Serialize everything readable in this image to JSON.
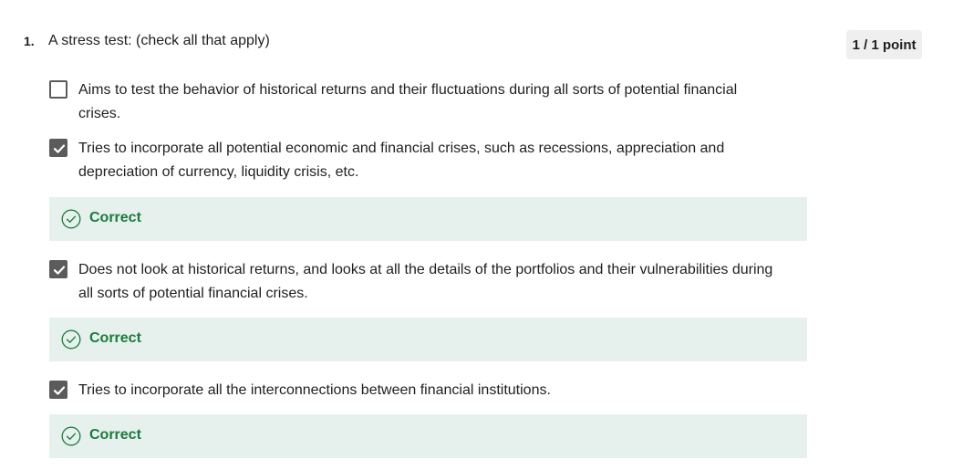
{
  "question": {
    "number": "1.",
    "text": "A stress test: (check all that apply)",
    "points": "1 / 1 point"
  },
  "options": [
    {
      "label": "Aims to test the behavior of historical returns and their fluctuations during all sorts of potential financial crises.",
      "checked": false
    },
    {
      "label": "Tries to incorporate all potential economic and financial crises, such as recessions, appreciation and depreciation of currency, liquidity crisis, etc.",
      "checked": true,
      "feedback": "Correct"
    },
    {
      "label": "Does not look at historical returns, and looks at all the details of the portfolios and their vulnerabilities during all sorts of potential financial crises.",
      "checked": true,
      "feedback": "Correct"
    },
    {
      "label": "Tries to incorporate all the interconnections between financial institutions.",
      "checked": true,
      "feedback": "Correct"
    }
  ],
  "icons": {
    "checkbox_checked": "check-icon",
    "feedback": "check-circle-icon"
  },
  "colors": {
    "correct_text": "#1d7a3f",
    "correct_bg": "#e6f0ec",
    "checkbox": "#5b5b5b"
  }
}
